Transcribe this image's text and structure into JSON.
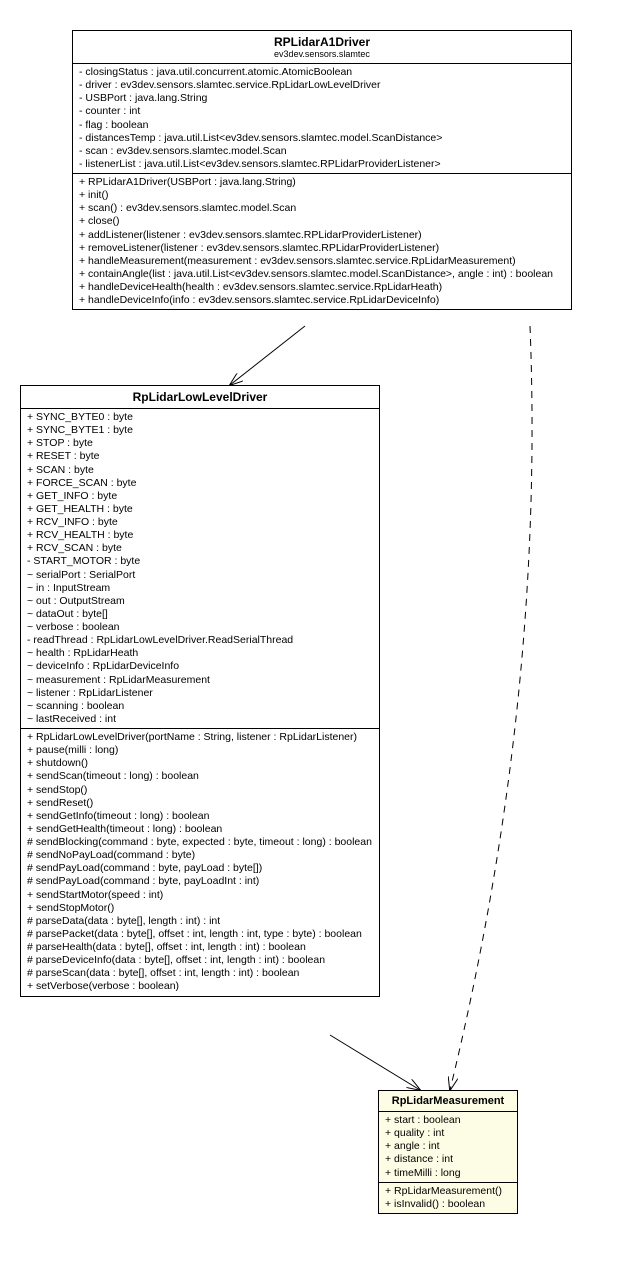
{
  "classes": {
    "a1": {
      "name": "RPLidarA1Driver",
      "package": "ev3dev.sensors.slamtec",
      "fields": [
        "- closingStatus : java.util.concurrent.atomic.AtomicBoolean",
        "- driver : ev3dev.sensors.slamtec.service.RpLidarLowLevelDriver",
        "- USBPort : java.lang.String",
        "- counter : int",
        "- flag : boolean",
        "- distancesTemp : java.util.List<ev3dev.sensors.slamtec.model.ScanDistance>",
        "- scan : ev3dev.sensors.slamtec.model.Scan",
        "- listenerList : java.util.List<ev3dev.sensors.slamtec.RPLidarProviderListener>"
      ],
      "methods": [
        "+ RPLidarA1Driver(USBPort : java.lang.String)",
        "+ init()",
        "+ scan() : ev3dev.sensors.slamtec.model.Scan",
        "+ close()",
        "+ addListener(listener : ev3dev.sensors.slamtec.RPLidarProviderListener)",
        "+ removeListener(listener : ev3dev.sensors.slamtec.RPLidarProviderListener)",
        "+ handleMeasurement(measurement : ev3dev.sensors.slamtec.service.RpLidarMeasurement)",
        "+ containAngle(list : java.util.List<ev3dev.sensors.slamtec.model.ScanDistance>, angle : int) : boolean",
        "+ handleDeviceHealth(health : ev3dev.sensors.slamtec.service.RpLidarHeath)",
        "+ handleDeviceInfo(info : ev3dev.sensors.slamtec.service.RpLidarDeviceInfo)"
      ]
    },
    "ll": {
      "name": "RpLidarLowLevelDriver",
      "fields": [
        "+ SYNC_BYTE0 : byte",
        "+ SYNC_BYTE1 : byte",
        "+ STOP : byte",
        "+ RESET : byte",
        "+ SCAN : byte",
        "+ FORCE_SCAN : byte",
        "+ GET_INFO : byte",
        "+ GET_HEALTH : byte",
        "+ RCV_INFO : byte",
        "+ RCV_HEALTH : byte",
        "+ RCV_SCAN : byte",
        "- START_MOTOR : byte",
        "~ serialPort : SerialPort",
        "~ in : InputStream",
        "~ out : OutputStream",
        "~ dataOut : byte[]",
        "~ verbose : boolean",
        "- readThread : RpLidarLowLevelDriver.ReadSerialThread",
        "~ health : RpLidarHeath",
        "~ deviceInfo : RpLidarDeviceInfo",
        "~ measurement : RpLidarMeasurement",
        "~ listener : RpLidarListener",
        "~ scanning : boolean",
        "~ lastReceived : int"
      ],
      "methods": [
        "+ RpLidarLowLevelDriver(portName : String, listener : RpLidarListener)",
        "+ pause(milli : long)",
        "+ shutdown()",
        "+ sendScan(timeout : long) : boolean",
        "+ sendStop()",
        "+ sendReset()",
        "+ sendGetInfo(timeout : long) : boolean",
        "+ sendGetHealth(timeout : long) : boolean",
        "# sendBlocking(command : byte, expected : byte, timeout : long) : boolean",
        "# sendNoPayLoad(command : byte)",
        "# sendPayLoad(command : byte, payLoad : byte[])",
        "# sendPayLoad(command : byte, payLoadInt : int)",
        "+ sendStartMotor(speed : int)",
        "+ sendStopMotor()",
        "# parseData(data : byte[], length : int) : int",
        "# parsePacket(data : byte[], offset : int, length : int, type : byte) : boolean",
        "# parseHealth(data : byte[], offset : int, length : int) : boolean",
        "# parseDeviceInfo(data : byte[], offset : int, length : int) : boolean",
        "# parseScan(data : byte[], offset : int, length : int) : boolean",
        "+ setVerbose(verbose : boolean)"
      ]
    },
    "meas": {
      "name": "RpLidarMeasurement",
      "fields": [
        "+ start : boolean",
        "+ quality : int",
        "+ angle : int",
        "+ distance : int",
        "+ timeMilli : long"
      ],
      "methods": [
        "+ RpLidarMeasurement()",
        "+ isInvalid() : boolean"
      ]
    }
  }
}
